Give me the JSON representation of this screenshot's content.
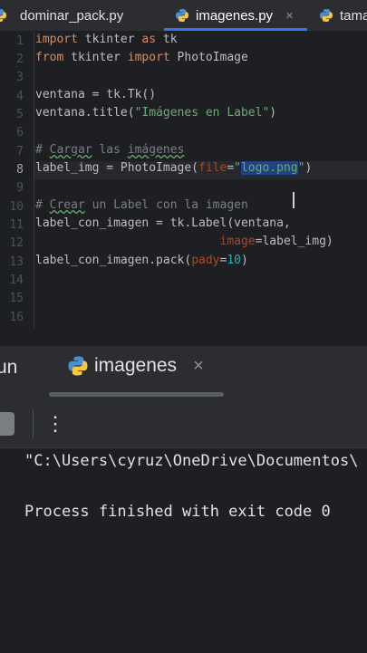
{
  "tabs": [
    {
      "label": "dominar_pack.py",
      "active": false
    },
    {
      "label": "imagenes.py",
      "active": true,
      "close": "×"
    },
    {
      "label": "tama",
      "active": false
    }
  ],
  "editor": {
    "line_numbers": [
      "1",
      "2",
      "3",
      "4",
      "5",
      "6",
      "7",
      "8",
      "9",
      "10",
      "11",
      "12",
      "13",
      "14",
      "15",
      "16"
    ],
    "current_line": 8,
    "code": {
      "l1_kw1": "import",
      "l1_mod": " tkinter ",
      "l1_kw2": "as",
      "l1_alias": " tk",
      "l2_kw1": "from",
      "l2_mod": " tkinter ",
      "l2_kw2": "import",
      "l2_name": " PhotoImage",
      "l4": "ventana = tk.Tk()",
      "l5_pre": "ventana.title(",
      "l5_str": "\"Imágenes en Label\"",
      "l5_post": ")",
      "l7_hash": "# ",
      "l7_w1": "Cargar",
      "l7_mid": " las ",
      "l7_w2": "imágenes",
      "l8_pre": "label_img = PhotoImage(",
      "l8_param": "file",
      "l8_eq": "=",
      "l8_q1": "\"",
      "l8_val": "logo.png",
      "l8_q2": "\"",
      "l8_post": ")",
      "l10_hash": "# ",
      "l10_w1": "Crear",
      "l10_rest": " un Label con la imagen",
      "l11": "label_con_imagen = tk.Label(ventana,",
      "l12_pad": "                          ",
      "l12_param": "image",
      "l12_rest": "=label_img)",
      "l13_pre": "label_con_imagen.pack(",
      "l13_param": "pady",
      "l13_eq": "=",
      "l13_num": "10",
      "l13_post": ")"
    }
  },
  "run_panel": {
    "tool_label": "un",
    "tab_label": "imagenes",
    "close": "×",
    "kebab": "⋮",
    "console_lines": [
      "\"C:\\Users\\cyruz\\OneDrive\\Documentos\\",
      "",
      "Process finished with exit code 0"
    ]
  },
  "colors": {
    "background": "#1e1f22",
    "panel": "#2b2d30",
    "accent": "#3574f0",
    "keyword": "#cf8e6d",
    "string": "#6aab73",
    "number": "#2aacb8",
    "param": "#aa4926",
    "comment": "#7a7e85"
  }
}
